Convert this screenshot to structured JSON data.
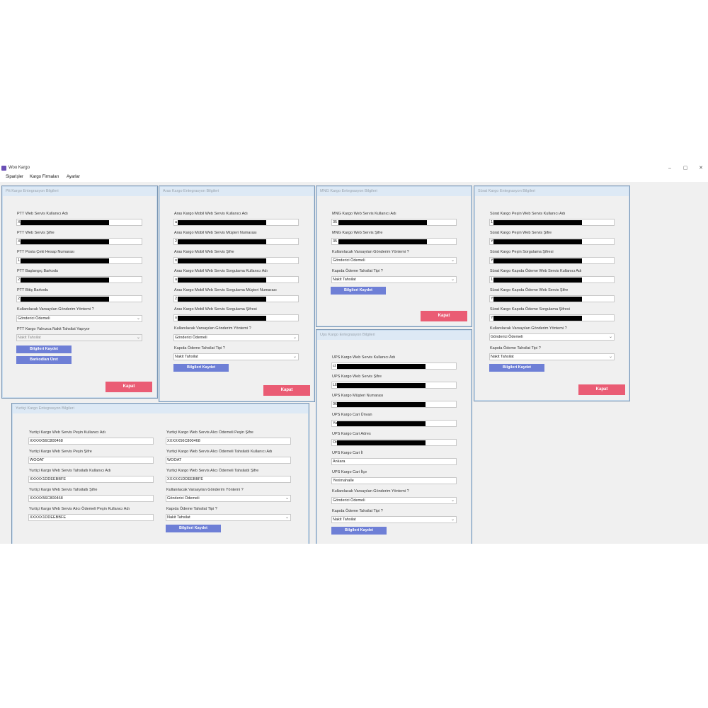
{
  "window": {
    "title": "Woo Kargo",
    "minimize": "–",
    "maximize": "▢",
    "close": "✕",
    "icon": "app-icon"
  },
  "menu": {
    "siparisler": "Siparişler",
    "kargo_firmalari": "Kargo Firmaları",
    "ayarlar": "Ayarlar"
  },
  "ptt": {
    "title": "Ptt Kargo Entegrasyon Bilgileri",
    "f1_label": "PTT Web Servis Kullanıcı Adı",
    "f1_value": "X",
    "f2_label": "PTT Web Servis Şifre",
    "f2_value": "X",
    "f3_label": "PTT Posta Çeki Hesap Numarası",
    "f3_value": "1",
    "f4_label": "PTT Başlangıç Barkodu",
    "f4_value": "2",
    "f5_label": "PTT Bitiş Barkodu",
    "f5_value": "2",
    "method_label": "Kullanılacak Varsayılan Gönderim Yöntemi ?",
    "method_value": "Gönderici Ödemeli",
    "cash_label": "PTT Kargo Yalnızca Nakit Tahsilat Yapıyor",
    "cash_value": "Nakit Tahsilat",
    "save": "Bilgileri Kaydet",
    "barcodes": "Barkodları Üret",
    "close": "Kapat"
  },
  "aras": {
    "title": "Aras Kargo Entegrasyon Bilgileri",
    "f1_label": "Aras Kargo Mobil Web Servis Kullanıcı Adı",
    "f1_value": "a",
    "f2_label": "Aras Kargo Mobil Web Servis Müşteri Numarası",
    "f2_value": "2",
    "f3_label": "Aras Kargo Mobil Web Servis Şifre",
    "f3_value": "o",
    "f4_label": "Aras Kargo Mobil Web Servis Sorgulama Kullanıcı Adı",
    "f4_value": "a",
    "f5_label": "Aras Kargo Mobil Web Servis Sorgulama Müşteri Numarası",
    "f5_value": "2",
    "f6_label": "Aras Kargo Mobil Web Servis Sorgulama Şifresi",
    "f6_value": "o",
    "method_label": "Kullanılacak Varsayılan Gönderim Yöntemi ?",
    "method_value": "Gönderici Ödemeli",
    "payment_label": "Kapıda Ödeme Tahsilat Tipi ?",
    "payment_value": "Nakit Tahsilat",
    "save": "Bilgileri Kaydet",
    "close": "Kapat"
  },
  "mng": {
    "title": "MNG Kargo Entegrasyon Bilgileri",
    "f1_label": "MNG Kargo Web Servis Kullanıcı Adı",
    "f1_value": "35",
    "f2_label": "MNG Kargo Web Servis Şifre",
    "f2_value": "35",
    "method_label": "Kullanılacak Varsayılan Gönderim Yöntemi ?",
    "method_value": "Gönderici Ödemeli",
    "payment_label": "Kapıda Ödeme Tahsilat Tipi ?",
    "payment_value": "Nakit Tahsilat",
    "save": "Bilgileri Kaydet",
    "close": "Kapat"
  },
  "surat": {
    "title": "Sürat Kargo Entegrasyon Bilgileri",
    "f1_label": "Sürat Kargo Peşin Web Servis Kullanıcı Adı",
    "f1_value": "1",
    "f2_label": "Sürat Kargo Peşin Web Servis Şifre",
    "f2_value": "Y",
    "f3_label": "Sürat Kargo Peşin Sorgulama Şifresi",
    "f3_value": "Y",
    "f4_label": "Sürat Kargo Kapıda Ödeme Web Servis Kullanıcı Adı",
    "f4_value": "1",
    "f5_label": "Sürat Kargo Kapıda Ödeme Web Servis Şifre",
    "f5_value": "Y",
    "f6_label": "Sürat Kargo Kapıda Ödeme Sorgulama Şifresi",
    "f6_value": "Y",
    "method_label": "Kullanılacak Varsayılan Gönderim Yöntemi ?",
    "method_value": "Gönderici Ödemeli",
    "payment_label": "Kapıda Ödeme Tahsilat Tipi ?",
    "payment_value": "Nakit Tahsilat",
    "save": "Bilgileri Kaydet",
    "close": "Kapat"
  },
  "ups": {
    "title": "Ups Kargo Entegrasyon Bilgileri",
    "f1_label": "UPS Kargo Web Servis Kullanıcı Adı",
    "f1_value": "ct",
    "f2_label": "UPS Kargo Web Servis Şifre",
    "f2_value": "LE",
    "f3_label": "UPS Kargo Müşteri Numarası",
    "f3_value": "06",
    "f4_label": "UPS Kargo Cari Ünvan",
    "f4_value": "Ya",
    "f5_label": "UPS Kargo Cari Adres",
    "f5_value": "Ot",
    "f6_label": "UPS Kargo Cari İl",
    "f6_value": "Ankara",
    "f7_label": "UPS Kargo Cari İlçe",
    "f7_value": "Yenimahalle",
    "method_label": "Kullanılacak Varsayılan Gönderim Yöntemi ?",
    "method_value": "Gönderici Ödemeli",
    "payment_label": "Kapıda Ödeme Tahsilat Tipi ?",
    "payment_value": "Nakit Tahsilat",
    "save": "Bilgileri Kaydet"
  },
  "yurtici": {
    "title": "Yurtiçi Kargo Entegrasyon Bilgileri",
    "l1_label": "Yurtiçi Kargo Web Servis Peşin Kullanıcı Adı",
    "l1_value": "XXXXX56C800468",
    "l2_label": "Yurtiçi Kargo Web Servis Peşin Şifre",
    "l2_value": "WOOAT",
    "l3_label": "Yurtiçi Kargo Web Servis Tahsilatlı Kullanıcı Adı",
    "l3_value": "XXXXX1DDEEBBFE",
    "l4_label": "Yurtiçi Kargo Web Servis Tahsilatlı Şifre",
    "l4_value": "XXXXX56C800468",
    "l5_label": "Yurtiçi Kargo Web Servis Alıcı Ödemeli Peşin Kullanıcı Adı",
    "l5_value": "XXXXX1DDEEBBFE",
    "r1_label": "Yurtiçi Kargo Web Servis Alıcı Ödemeli Peşin Şifre",
    "r1_value": "XXXXX56C800468",
    "r2_label": "Yurtiçi Kargo Web Servis Alıcı Ödemeli Tahsilatlı Kullanıcı Adı",
    "r2_value": "WOOAT",
    "r3_label": "Yurtiçi Kargo Web Servis Alıcı Ödemeli Tahsilatlı Şifre",
    "r3_value": "XXXXX1DDEEBBFE",
    "method_label": "Kullanılacak Varsayılan Gönderim Yöntemi ?",
    "method_value": "Gönderici Ödemeli",
    "payment_label": "Kapıda Ödeme Tahsilat Tipi ?",
    "payment_value": "Nakit Tahsilat",
    "save": "Bilgileri Kaydet"
  },
  "colors": {
    "panel_border": "#7a96b4",
    "save_button": "#6e7fd6",
    "close_button": "#ea5c74"
  }
}
